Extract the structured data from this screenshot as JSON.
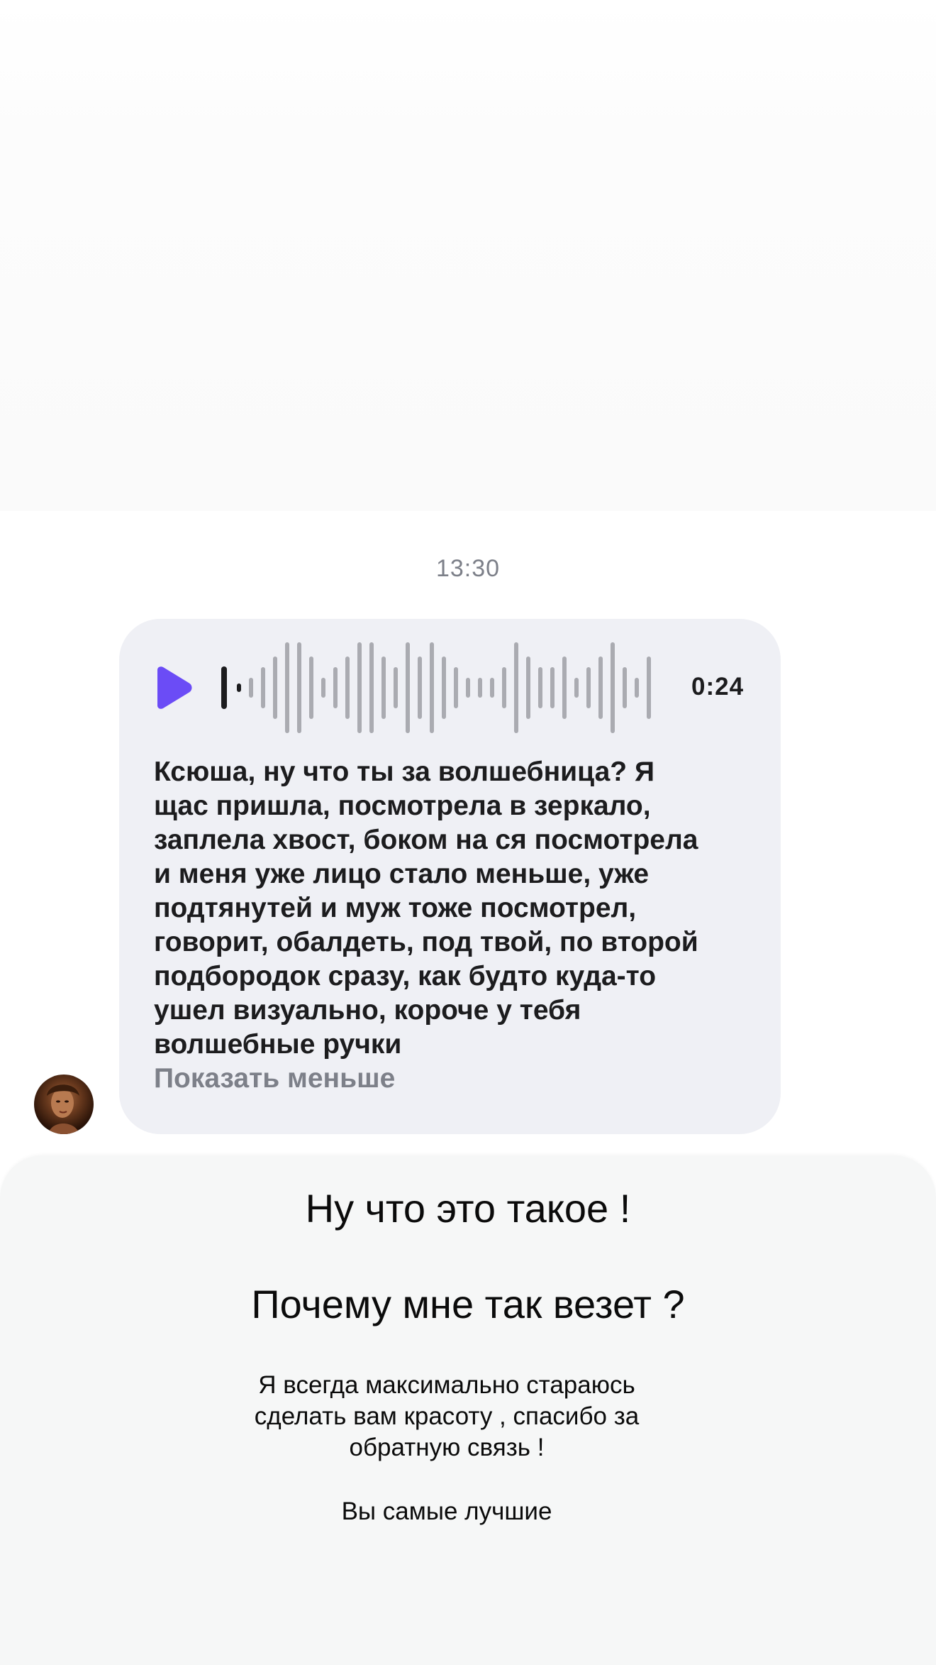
{
  "chat": {
    "timestamp": "13:30",
    "voice_message": {
      "duration": "0:24",
      "play_icon": "play-icon",
      "accent_color": "#6b4cf6",
      "transcript": "Ксюша, ну что ты за волшебница? Я\nщас пришла, посмотрела в зеркало,\nзаплела хвост, боком на ся посмотрела\nи меня уже лицо стало меньше, уже\nподтянутей и муж тоже посмотрел,\nговорит, обалдеть, под твой, по второй\nподбородок сразу, как будто куда-то\nушел визуально, короче у тебя\nволшебные ручки",
      "show_less_label": "Показать меньше"
    },
    "sender_avatar": "avatar-photo"
  },
  "caption": {
    "title_1": "Ну что это такое !",
    "title_2": "Почему мне так везет ?",
    "body": "Я всегда максимально стараюсь\nсделать вам красоту , спасибо за\nобратную связь !",
    "closing": "Вы самые лучшие"
  }
}
